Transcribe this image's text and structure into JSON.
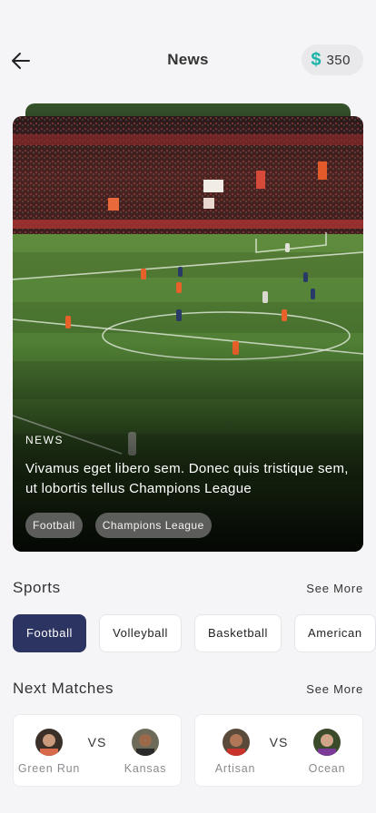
{
  "header": {
    "title": "News",
    "back_icon": "arrow-left-icon",
    "coins": {
      "icon": "$",
      "value": "350",
      "color": "#1ab5a8"
    }
  },
  "hero": {
    "kicker": "NEWS",
    "headline": "Vivamus eget libero sem. Donec quis tristique sem, ut lobortis tellus Champions League",
    "tags": [
      "Football",
      "Champions League"
    ]
  },
  "sports": {
    "title": "Sports",
    "see_more": "See More",
    "categories": [
      {
        "label": "Football",
        "active": true
      },
      {
        "label": "Volleyball",
        "active": false
      },
      {
        "label": "Basketball",
        "active": false
      },
      {
        "label": "American",
        "active": false
      }
    ],
    "active_color": "#2c3461"
  },
  "matches": {
    "title": "Next Matches",
    "see_more": "See More",
    "items": [
      {
        "home": "Green Run",
        "vs": "VS",
        "away": "Kansas"
      },
      {
        "home": "Artisan",
        "vs": "VS",
        "away": "Ocean"
      }
    ]
  }
}
